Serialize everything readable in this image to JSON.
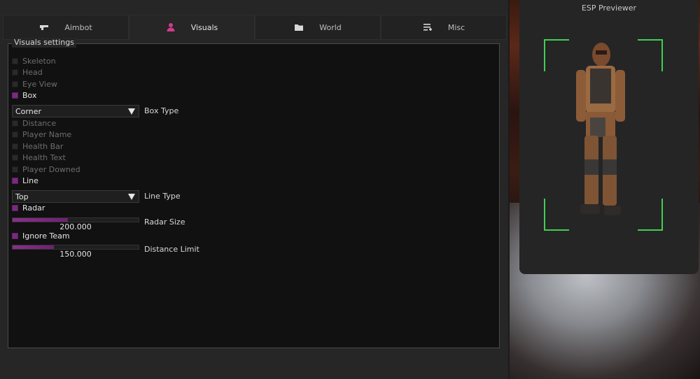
{
  "tabs": [
    {
      "label": "Aimbot",
      "icon": "gun-icon"
    },
    {
      "label": "Visuals",
      "icon": "person-icon"
    },
    {
      "label": "World",
      "icon": "folder-icon"
    },
    {
      "label": "Misc",
      "icon": "list-add-icon"
    }
  ],
  "active_tab": "Visuals",
  "group_title": "Visuals settings",
  "options": {
    "skeleton": "Skeleton",
    "head": "Head",
    "eye_view": "Eye View",
    "box": "Box",
    "box_type_value": "Corner",
    "box_type_label": "Box Type",
    "distance": "Distance",
    "player_name": "Player Name",
    "health_bar": "Health Bar",
    "health_text": "Health Text",
    "player_downed": "Player Downed",
    "line": "Line",
    "line_type_value": "Top",
    "line_type_label": "Line Type",
    "radar": "Radar",
    "radar_size_value": "200.000",
    "radar_size_label": "Radar Size",
    "radar_size_fraction": 0.44,
    "ignore_team": "Ignore Team",
    "distance_limit_value": "150.000",
    "distance_limit_label": "Distance Limit",
    "distance_limit_fraction": 0.33
  },
  "preview": {
    "title": "ESP Previewer",
    "box_color": "#3fcf52"
  },
  "colors": {
    "accent": "#7a2b80",
    "tab_icon_active": "#d23a8a"
  }
}
